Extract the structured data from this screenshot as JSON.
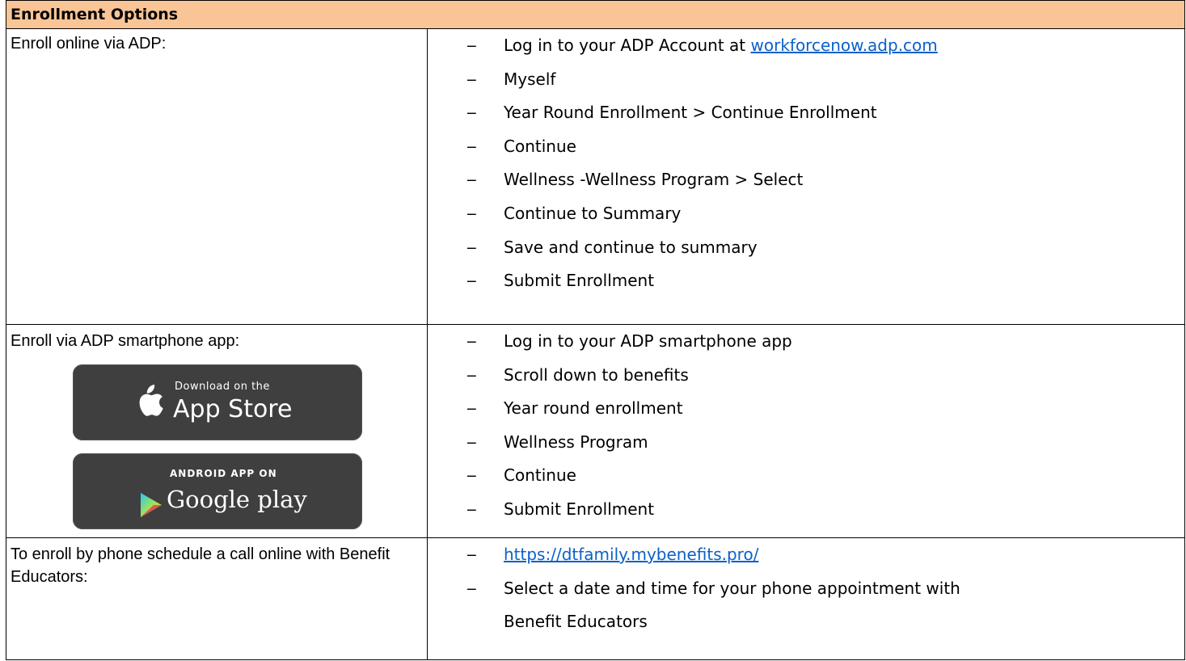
{
  "header": {
    "title": "Enrollment Options"
  },
  "rows": [
    {
      "label": "Enroll online via ADP:",
      "steps": [
        {
          "pre": "Log in to your ADP Account at ",
          "link": "workforcenow.adp.com"
        },
        {
          "text": "Myself"
        },
        {
          "text": "Year Round Enrollment > Continue Enrollment"
        },
        {
          "text": "Continue"
        },
        {
          "text": "Wellness -Wellness Program > Select"
        },
        {
          "text": "Continue to Summary"
        },
        {
          "text": "Save and continue to summary"
        },
        {
          "text": "Submit Enrollment"
        }
      ]
    },
    {
      "label": "Enroll via ADP smartphone app:",
      "badges": {
        "app_store": {
          "small": "Download on the",
          "big": "App Store",
          "icon": "apple-icon"
        },
        "google_play": {
          "small": "ANDROID APP ON",
          "big": "Google play",
          "icon": "play-triangle-icon"
        }
      },
      "steps": [
        {
          "text": "Log in to your ADP smartphone app"
        },
        {
          "text": "Scroll down to benefits"
        },
        {
          "text": "Year round enrollment"
        },
        {
          "text": "Wellness Program"
        },
        {
          "text": "Continue"
        },
        {
          "text": "Submit Enrollment"
        }
      ]
    },
    {
      "label": "To enroll by phone schedule a call online with Benefit Educators:",
      "steps": [
        {
          "link": "https://dtfamily.mybenefits.pro/"
        },
        {
          "text": "Select a date and time for your phone appointment with Benefit Educators"
        }
      ]
    }
  ],
  "bullet": "‒",
  "colors": {
    "header_bg": "#f9c596",
    "link": "#0b61c8",
    "badge_bg": "#3f3f3f"
  }
}
